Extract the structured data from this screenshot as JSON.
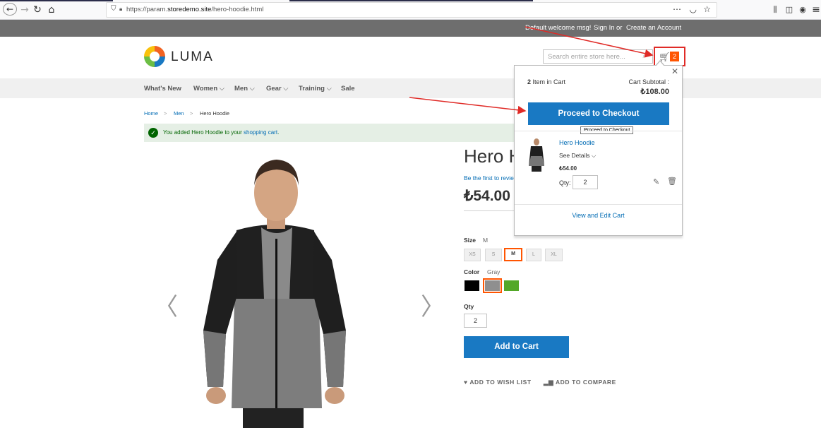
{
  "browser": {
    "url_prefix": "https://param.",
    "url_domain": "storedemo.site",
    "url_path": "/hero-hoodie.html",
    "more_icon": "⋯",
    "icons": [
      "back-icon",
      "forward-icon",
      "reload-icon",
      "home-icon",
      "shield-icon",
      "lock-icon",
      "pocket-icon",
      "bookmark-star-icon",
      "library-icon",
      "sidebar-icon",
      "account-icon",
      "menu-icon"
    ]
  },
  "panel": {
    "welcome": "Default welcome msg!",
    "sign_in": "Sign In",
    "or": "or",
    "create_account": "Create an Account"
  },
  "header": {
    "logo_text": "LUMA",
    "search_placeholder": "Search entire store here...",
    "cart_count": "2"
  },
  "nav": {
    "items": [
      "What's New",
      "Women",
      "Men",
      "Gear",
      "Training",
      "Sale"
    ]
  },
  "breadcrumb": {
    "home": "Home",
    "men": "Men",
    "current": "Hero Hoodie",
    "separator": ">"
  },
  "message": {
    "text": "You added Hero Hoodie to your",
    "link": "shopping cart",
    "end": "."
  },
  "product": {
    "name": "Hero Hoodie",
    "review_link": "Be the first to review this product",
    "price": "₺54.00",
    "size_label": "Size",
    "size_selected": "M",
    "sizes": [
      "XS",
      "S",
      "M",
      "L",
      "XL"
    ],
    "color_label": "Color",
    "color_selected": "Gray",
    "colors": [
      "#000000",
      "#8f8f8f",
      "#53a828"
    ],
    "qty_label": "Qty",
    "qty_value": "2",
    "add_to_cart": "Add to Cart",
    "wishlist": "ADD TO WISH LIST",
    "compare": "ADD TO COMPARE"
  },
  "minicart": {
    "items_count": "2",
    "items_label": "Item in Cart",
    "subtotal_label": "Cart Subtotal :",
    "subtotal": "₺108.00",
    "checkout": "Proceed to Checkout",
    "tooltip": "Proceed to Checkout",
    "item_name": "Hero Hoodie",
    "see_details": "See Details",
    "item_price": "₺54.00",
    "qty_label": "Qty:",
    "qty_value": "2",
    "view_edit": "View and Edit Cart"
  },
  "colors": {
    "accent_blue": "#1979c3",
    "link_blue": "#006bb4",
    "orange": "#ff5501",
    "annotation_red": "#e02b27"
  }
}
